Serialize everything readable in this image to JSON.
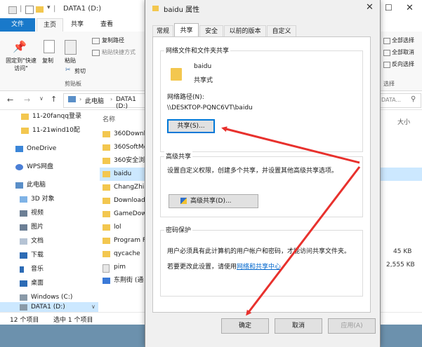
{
  "explorer": {
    "title": "DATA1 (D:)",
    "ribbon_tabs": [
      "文件",
      "主页",
      "共享",
      "查看"
    ],
    "clipboard": {
      "pin_label": "固定到\"快速访问\"",
      "copy_label": "复制",
      "paste_label": "粘贴",
      "copy_path": "复制路径",
      "paste_shortcut": "粘贴快捷方式",
      "cut": "剪切",
      "group_label": "剪贴板"
    },
    "select": {
      "select_all": "全部选择",
      "select_none": "全部取消",
      "invert": "反向选择",
      "group_label": "选择"
    },
    "address": {
      "breadcrumb": [
        "此电脑",
        "DATA1 (D:)"
      ],
      "search_placeholder": "DATA..."
    },
    "nav_items": [
      "11-20fanqq登录",
      "11-21wind10配",
      "OneDrive",
      "WPS网盘",
      "此电脑",
      "3D 对象",
      "视频",
      "图片",
      "文档",
      "下载",
      "音乐",
      "桌面",
      "Windows (C:)",
      "DATA1 (D:)"
    ],
    "column_name": "名称",
    "column_size": "大小",
    "files": [
      "360Downloa",
      "360SoftMg",
      "360安全浏览",
      "baidu",
      "ChangZhi",
      "Download",
      "GameDow",
      "lol",
      "Program F",
      "qycache",
      "pim",
      "东荆街 (通"
    ],
    "sizes": [
      "45 KB",
      "2,555 KB"
    ],
    "status": {
      "count": "12 个项目",
      "selected": "选中 1 个项目"
    }
  },
  "dialog": {
    "title": "baidu 属性",
    "close_icon": "close-icon",
    "tabs": [
      "常规",
      "共享",
      "安全",
      "以前的版本",
      "自定义"
    ],
    "active_tab": "共享",
    "network_sharing": {
      "title": "网络文件和文件夹共享",
      "folder_name": "baidu",
      "folder_state": "共享式",
      "path_label": "网络路径(N):",
      "path_value": "\\\\DESKTOP-PQNC6VT\\baidu",
      "share_button": "共享(S)..."
    },
    "advanced_sharing": {
      "title": "高级共享",
      "desc": "设置自定义权限，创建多个共享，并设置其他高级共享选项。",
      "button": "高级共享(D)..."
    },
    "password": {
      "title": "密码保护",
      "desc": "用户必须具有此计算机的用户帐户和密码，才能访问共享文件夹。",
      "change_prefix": "若要更改此设置，请使用",
      "change_link": "网络和共享中心"
    },
    "ok_button": "确定",
    "cancel_button": "取消",
    "apply_button": "应用(A)"
  },
  "colors": {
    "accent": "#1979ca",
    "arrow": "#e8312d",
    "folder": "#f3c74f",
    "taskbar": "#6c91ad"
  }
}
